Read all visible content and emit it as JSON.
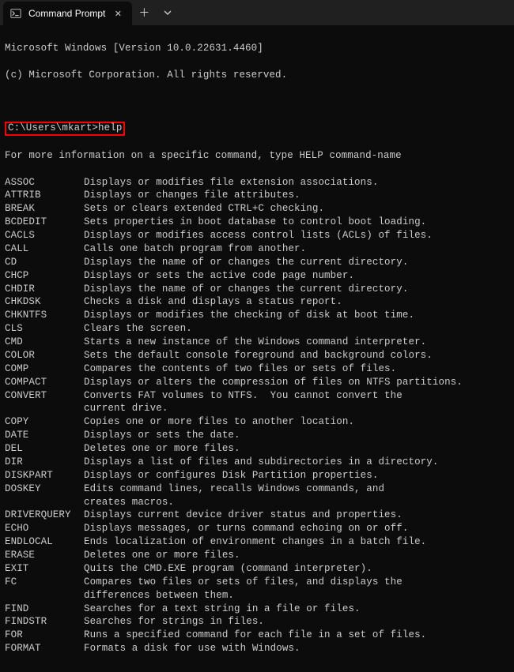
{
  "tab": {
    "title": "Command Prompt"
  },
  "banner": {
    "line1": "Microsoft Windows [Version 10.0.22631.4460]",
    "line2": "(c) Microsoft Corporation. All rights reserved."
  },
  "prompt": {
    "path": "C:\\Users\\mkart>",
    "command": "help"
  },
  "help_header": "For more information on a specific command, type HELP command-name",
  "commands": [
    {
      "cmd": "ASSOC",
      "desc": "Displays or modifies file extension associations."
    },
    {
      "cmd": "ATTRIB",
      "desc": "Displays or changes file attributes."
    },
    {
      "cmd": "BREAK",
      "desc": "Sets or clears extended CTRL+C checking."
    },
    {
      "cmd": "BCDEDIT",
      "desc": "Sets properties in boot database to control boot loading."
    },
    {
      "cmd": "CACLS",
      "desc": "Displays or modifies access control lists (ACLs) of files."
    },
    {
      "cmd": "CALL",
      "desc": "Calls one batch program from another."
    },
    {
      "cmd": "CD",
      "desc": "Displays the name of or changes the current directory."
    },
    {
      "cmd": "CHCP",
      "desc": "Displays or sets the active code page number."
    },
    {
      "cmd": "CHDIR",
      "desc": "Displays the name of or changes the current directory."
    },
    {
      "cmd": "CHKDSK",
      "desc": "Checks a disk and displays a status report."
    },
    {
      "cmd": "CHKNTFS",
      "desc": "Displays or modifies the checking of disk at boot time."
    },
    {
      "cmd": "CLS",
      "desc": "Clears the screen."
    },
    {
      "cmd": "CMD",
      "desc": "Starts a new instance of the Windows command interpreter."
    },
    {
      "cmd": "COLOR",
      "desc": "Sets the default console foreground and background colors."
    },
    {
      "cmd": "COMP",
      "desc": "Compares the contents of two files or sets of files."
    },
    {
      "cmd": "COMPACT",
      "desc": "Displays or alters the compression of files on NTFS partitions."
    },
    {
      "cmd": "CONVERT",
      "desc": "Converts FAT volumes to NTFS.  You cannot convert the\ncurrent drive."
    },
    {
      "cmd": "COPY",
      "desc": "Copies one or more files to another location."
    },
    {
      "cmd": "DATE",
      "desc": "Displays or sets the date."
    },
    {
      "cmd": "DEL",
      "desc": "Deletes one or more files."
    },
    {
      "cmd": "DIR",
      "desc": "Displays a list of files and subdirectories in a directory."
    },
    {
      "cmd": "DISKPART",
      "desc": "Displays or configures Disk Partition properties."
    },
    {
      "cmd": "DOSKEY",
      "desc": "Edits command lines, recalls Windows commands, and\ncreates macros."
    },
    {
      "cmd": "DRIVERQUERY",
      "desc": "Displays current device driver status and properties."
    },
    {
      "cmd": "ECHO",
      "desc": "Displays messages, or turns command echoing on or off."
    },
    {
      "cmd": "ENDLOCAL",
      "desc": "Ends localization of environment changes in a batch file."
    },
    {
      "cmd": "ERASE",
      "desc": "Deletes one or more files."
    },
    {
      "cmd": "EXIT",
      "desc": "Quits the CMD.EXE program (command interpreter)."
    },
    {
      "cmd": "FC",
      "desc": "Compares two files or sets of files, and displays the\ndifferences between them."
    },
    {
      "cmd": "FIND",
      "desc": "Searches for a text string in a file or files."
    },
    {
      "cmd": "FINDSTR",
      "desc": "Searches for strings in files."
    },
    {
      "cmd": "FOR",
      "desc": "Runs a specified command for each file in a set of files."
    },
    {
      "cmd": "FORMAT",
      "desc": "Formats a disk for use with Windows."
    }
  ]
}
